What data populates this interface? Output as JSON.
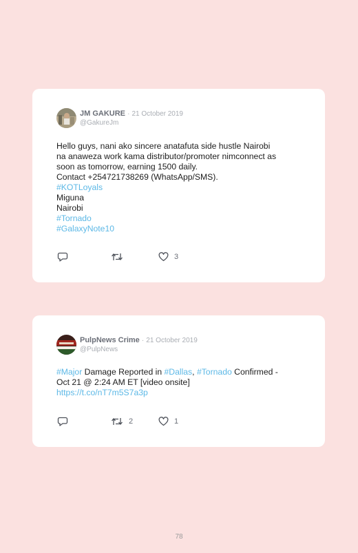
{
  "tweets": [
    {
      "author": "JM GAKURE",
      "separator": "·",
      "date": "21 October 2019",
      "handle": "@GakureJm",
      "lines": [
        "Hello guys, nani ako sincere anatafuta side hustle Nairobi",
        "na anaweza work kama distributor/promoter nimconnect as",
        "soon as tomorrow, earning 1500 daily.",
        "Contact +254721738269 (WhatsApp/SMS).",
        "#KOTLoyals",
        "Miguna",
        "Nairobi",
        "#Tornado",
        "#GalaxyNote10"
      ],
      "likes": "3"
    },
    {
      "author": "PulpNews Crime",
      "separator": "·",
      "date": "21 October 2019",
      "handle": "@PulpNews",
      "line1": {
        "tag1": "#Major",
        "t1": " Damage Reported in ",
        "tag2": "#Dallas",
        "t2": ", ",
        "tag3": "#Tornado",
        "t3": " Confirmed -"
      },
      "line2": "Oct 21 @ 2:24 AM ET [video onsite]",
      "link": "https://t.co/nT7m5S7a3p",
      "retweets": "2",
      "likes": "1"
    }
  ],
  "colors": {
    "background": "#fbe1e0",
    "hashtag": "#5cb8e6",
    "card": "#ffffff"
  },
  "icons": [
    "reply-icon",
    "retweet-icon",
    "like-icon"
  ],
  "page_number": "78"
}
